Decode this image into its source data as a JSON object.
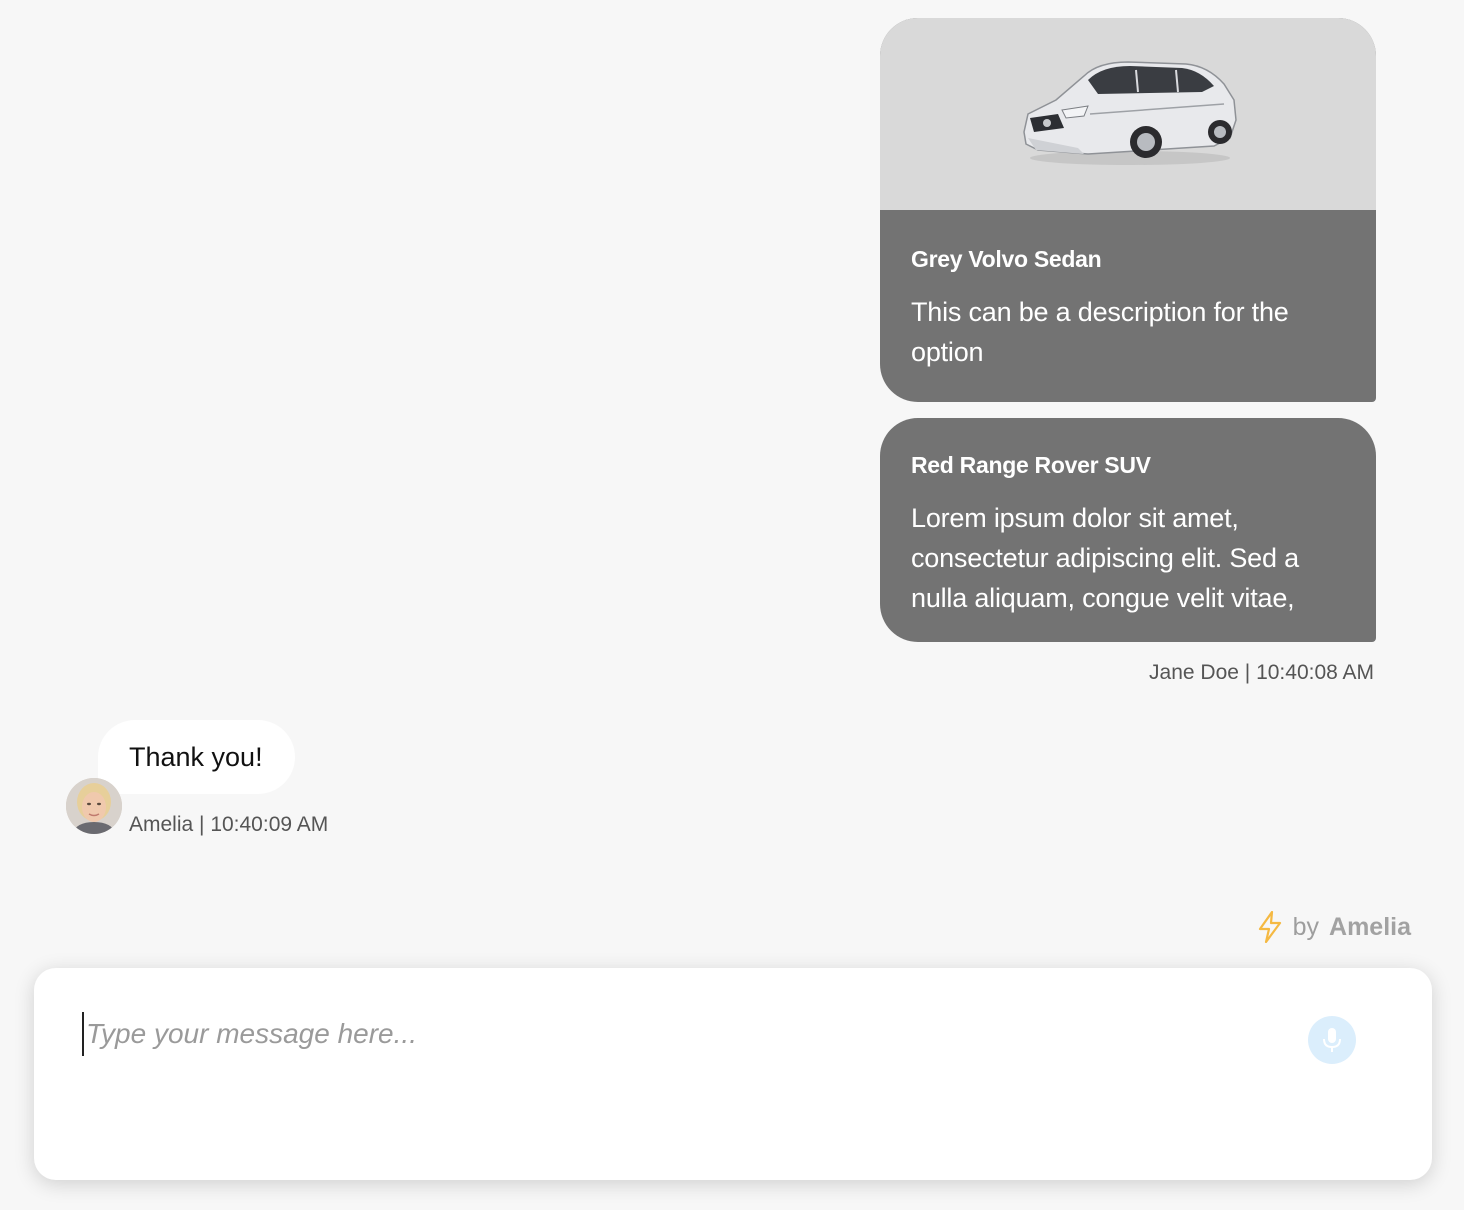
{
  "messages": {
    "cards": [
      {
        "image": "car-sedan-image",
        "title": "Grey Volvo Sedan",
        "description": "This can be a description for the option"
      },
      {
        "title": "Red Range Rover SUV",
        "description": "Lorem ipsum dolor sit amet, consectetur adipiscing elit. Sed a nulla aliquam, congue velit vitae,"
      }
    ],
    "user_meta": "Jane Doe | 10:40:08 AM",
    "bot": {
      "text": "Thank you!",
      "meta": "Amelia | 10:40:09 AM",
      "avatar": "amelia-avatar"
    }
  },
  "branding": {
    "prefix": "by",
    "name": "Amelia",
    "icon": "lightning-icon",
    "icon_color": "#f5b942"
  },
  "composer": {
    "placeholder": "Type your message here...",
    "value": "",
    "mic_icon": "microphone-icon",
    "mic_bg": "#dbeefc",
    "mic_color": "#6ec3f5"
  },
  "colors": {
    "card_bg": "#737373",
    "card_image_bg": "#d9d9d9",
    "page_bg": "#f7f7f7"
  }
}
